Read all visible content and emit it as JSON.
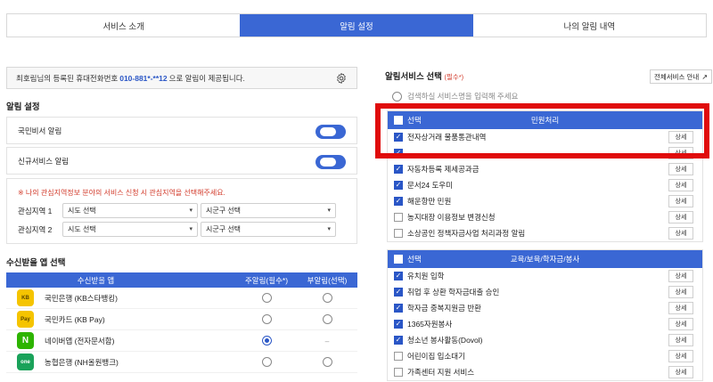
{
  "tabs": [
    "서비스 소개",
    "알림 설정",
    "나의 알림 내역"
  ],
  "notice": {
    "prefix": "최호림님의 등록된 휴대전화번호",
    "phone": "010-881*-**12",
    "suffix": "으로 알림이 제공됩니다."
  },
  "alert_settings": {
    "title": "알림 설정",
    "rows": [
      {
        "label": "국민비서 알림",
        "on": true
      },
      {
        "label": "신규서비스 알림",
        "on": true
      }
    ]
  },
  "region": {
    "note": "※ 나의 관심지역정보 분야의 서비스 신청 시 관심지역을 선택해주세요.",
    "rows": [
      {
        "label": "관심지역 1",
        "sido": "시도 선택",
        "sigungu": "시군구 선택"
      },
      {
        "label": "관심지역 2",
        "sido": "시도 선택",
        "sigungu": "시군구 선택"
      }
    ]
  },
  "apps": {
    "title": "수신받을 앱 선택",
    "headers": [
      "수신받을 앱",
      "주알림(필수*)",
      "부알림(선택)"
    ],
    "rows": [
      {
        "name": "국민은행 (KB스타뱅킹)",
        "icon": "KB",
        "icon_bg": "#f5c400",
        "main": false,
        "sub": "radio"
      },
      {
        "name": "국민카드 (KB Pay)",
        "icon": "Pay",
        "icon_bg": "#f5c400",
        "main": false,
        "sub": "radio"
      },
      {
        "name": "네이버앱 (전자문서함)",
        "icon": "N",
        "icon_bg": "#2db400",
        "main": true,
        "sub": "–"
      },
      {
        "name": "농협은행 (NH올원뱅크)",
        "icon": "one",
        "icon_bg": "#1aa25a",
        "main": false,
        "sub": "radio"
      }
    ]
  },
  "services": {
    "title": "알림서비스 선택",
    "required": "(필수*)",
    "all_button": "전체서비스 안내",
    "search_hint": "검색하실 서비스명을 입력해 주세요",
    "select_label": "선택",
    "detail_label": "상세",
    "categories": [
      {
        "name": "민원처리",
        "items": [
          {
            "label": "전자상거래 물품통관내역",
            "checked": true
          },
          {
            "label": "",
            "checked": true
          },
          {
            "label": "자동차등록 제세공과금",
            "checked": true
          },
          {
            "label": "문서24 도우미",
            "checked": true
          },
          {
            "label": "해운항만 민원",
            "checked": true
          },
          {
            "label": "농지대장 이용정보 변경신청",
            "checked": false
          },
          {
            "label": "소상공인 정책자금사업 처리과정 알림",
            "checked": false
          }
        ]
      },
      {
        "name": "교육/보육/학자금/봉사",
        "items": [
          {
            "label": "유치원 입학",
            "checked": true
          },
          {
            "label": "취업 후 상환 학자금대출 승인",
            "checked": true
          },
          {
            "label": "학자금 중복지원금 반환",
            "checked": true
          },
          {
            "label": "1365자원봉사",
            "checked": true
          },
          {
            "label": "청소년 봉사활동(Dovol)",
            "checked": true
          },
          {
            "label": "어린이집 입소대기",
            "checked": false
          },
          {
            "label": "가족센터 지원 서비스",
            "checked": false
          }
        ]
      }
    ]
  }
}
